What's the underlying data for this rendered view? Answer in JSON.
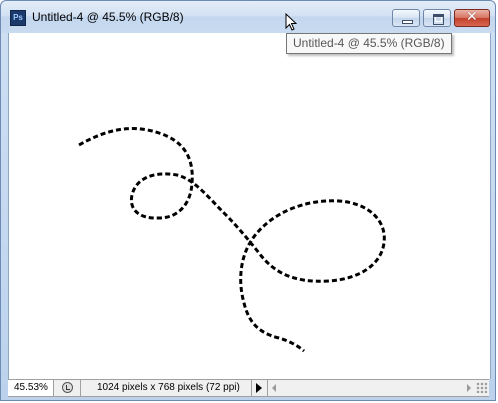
{
  "window": {
    "title": "Untitled-4 @ 45.5% (RGB/8)",
    "app_icon_label": "Ps",
    "tooltip": "Untitled-4 @ 45.5% (RGB/8)"
  },
  "status": {
    "zoom": "45.53%",
    "doc_info": "1024 pixels x 768 pixels (72 ppi)"
  },
  "canvas": {
    "selection": "freeform marching-ants path"
  }
}
